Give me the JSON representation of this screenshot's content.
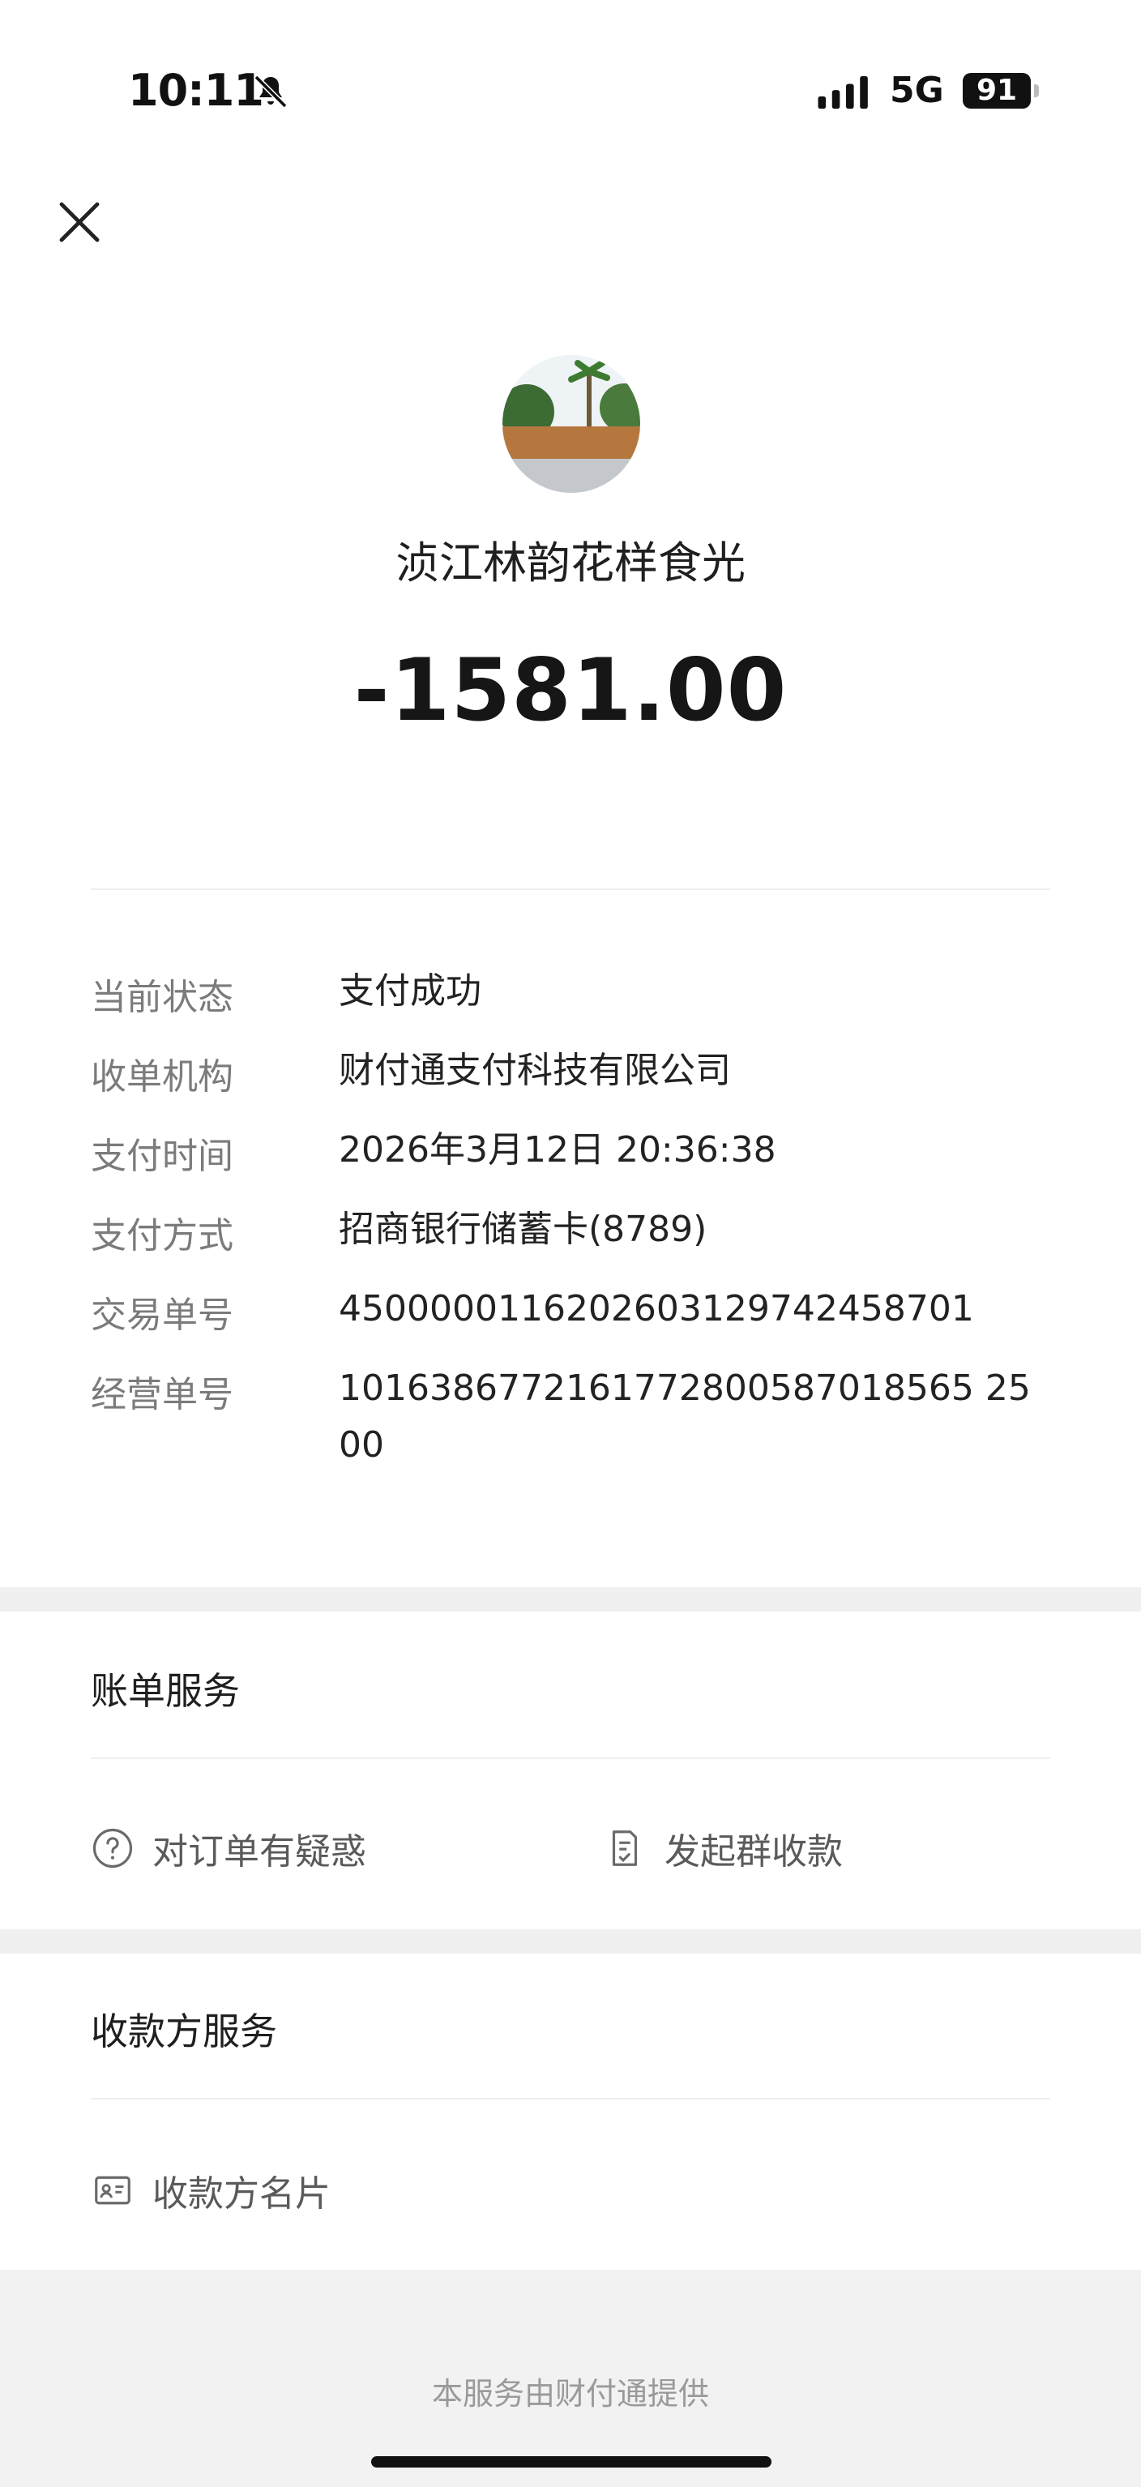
{
  "status_bar": {
    "time": "10:11",
    "network": "5G",
    "battery": "91",
    "icons": [
      "bell-muted-icon",
      "signal-icon",
      "battery-icon"
    ]
  },
  "merchant": {
    "name": "浈江林韵花样食光",
    "avatar_sign_text": "浈江林韵花样食光"
  },
  "amount": "-1581.00",
  "details": [
    {
      "label": "当前状态",
      "value": "支付成功"
    },
    {
      "label": "收单机构",
      "value": "财付通支付科技有限公司"
    },
    {
      "label": "支付时间",
      "value": "2026年3月12日 20:36:38"
    },
    {
      "label": "支付方式",
      "value": "招商银行储蓄卡(8789)"
    },
    {
      "label": "交易单号",
      "value": "4500000116202603129742458701"
    },
    {
      "label": "经营单号",
      "value": "1016386772161772800587018565 2500"
    }
  ],
  "bill_services": {
    "title": "账单服务",
    "items": [
      {
        "label": "对订单有疑惑",
        "icon": "question-circle-icon"
      },
      {
        "label": "发起群收款",
        "icon": "document-icon"
      }
    ]
  },
  "payee_services": {
    "title": "收款方服务",
    "items": [
      {
        "label": "收款方名片",
        "icon": "card-icon"
      }
    ]
  },
  "footer": "本服务由财付通提供",
  "colors": {
    "background": "#ffffff",
    "band": "#f0f0f0",
    "label": "#7b7b7b"
  }
}
